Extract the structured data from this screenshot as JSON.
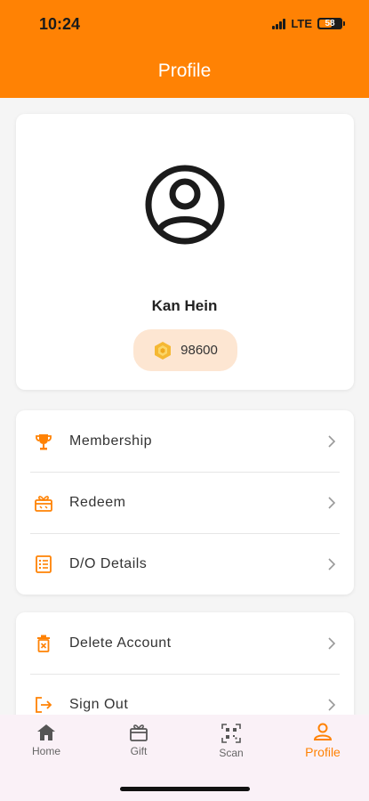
{
  "status_bar": {
    "time": "10:24",
    "network": "LTE",
    "battery": "58"
  },
  "header": {
    "title": "Profile"
  },
  "profile": {
    "name": "Kan Hein",
    "points": "98600"
  },
  "menu_main": [
    {
      "label": "Membership",
      "icon": "trophy-icon"
    },
    {
      "label": "Redeem",
      "icon": "gift-box-icon"
    },
    {
      "label": "D/O Details",
      "icon": "list-icon"
    }
  ],
  "menu_account": [
    {
      "label": "Delete Account",
      "icon": "delete-icon"
    },
    {
      "label": "Sign Out",
      "icon": "sign-out-icon"
    }
  ],
  "bottom_nav": [
    {
      "label": "Home",
      "icon": "home-icon"
    },
    {
      "label": "Gift",
      "icon": "gift-icon"
    },
    {
      "label": "Scan",
      "icon": "scan-icon"
    },
    {
      "label": "Profile",
      "icon": "profile-icon",
      "active": true
    }
  ],
  "colors": {
    "accent": "#ff8204",
    "points_bg": "#fde6d2",
    "nav_bg": "#faf1f7"
  }
}
